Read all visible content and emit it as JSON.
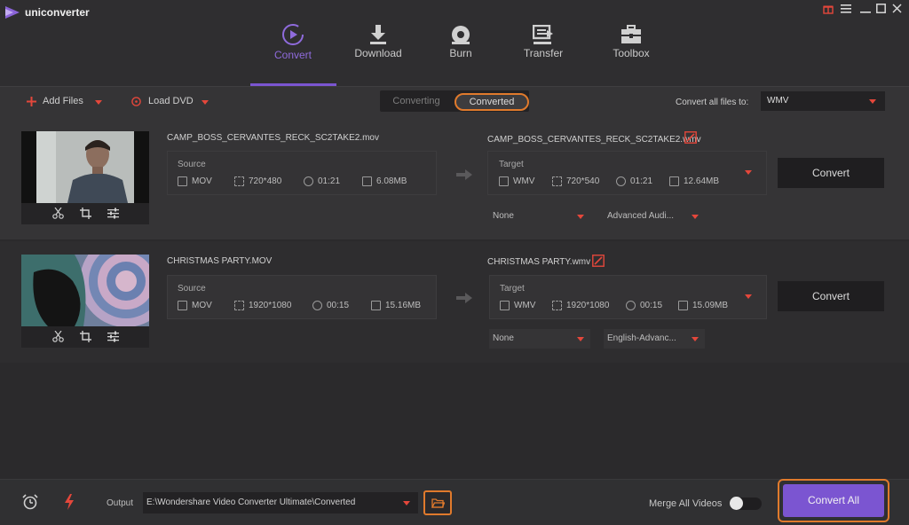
{
  "app": {
    "title": "uniconverter"
  },
  "nav": {
    "convert": "Convert",
    "download": "Download",
    "burn": "Burn",
    "transfer": "Transfer",
    "toolbox": "Toolbox"
  },
  "toolbar": {
    "add_files": "Add Files",
    "load_dvd": "Load DVD",
    "tab_converting": "Converting",
    "tab_converted": "Converted",
    "convert_all_to_label": "Convert all files to:",
    "convert_all_to_value": "WMV"
  },
  "items": [
    {
      "source_name": "CAMP_BOSS_CERVANTES_RECK_SC2TAKE2.mov",
      "source": {
        "label": "Source",
        "format": "MOV",
        "resolution": "720*480",
        "duration": "01:21",
        "size": "6.08MB"
      },
      "target_name": "CAMP_BOSS_CERVANTES_RECK_SC2TAKE2.wmv",
      "target": {
        "label": "Target",
        "format": "WMV",
        "resolution": "720*540",
        "duration": "01:21",
        "size": "12.64MB"
      },
      "subtitle": "None",
      "audio": "Advanced Audi...",
      "convert_label": "Convert"
    },
    {
      "source_name": "CHRISTMAS PARTY.MOV",
      "source": {
        "label": "Source",
        "format": "MOV",
        "resolution": "1920*1080",
        "duration": "00:15",
        "size": "15.16MB"
      },
      "target_name": "CHRISTMAS PARTY.wmv",
      "target": {
        "label": "Target",
        "format": "WMV",
        "resolution": "1920*1080",
        "duration": "00:15",
        "size": "15.09MB"
      },
      "subtitle": "None",
      "audio": "English-Advanc...",
      "convert_label": "Convert"
    }
  ],
  "bottom": {
    "output_label": "Output",
    "output_path": "E:\\Wondershare Video Converter Ultimate\\Converted",
    "merge_label": "Merge All Videos",
    "merge_on": false,
    "convert_all": "Convert All"
  },
  "colors": {
    "accent": "#7b55d1",
    "highlight": "#e07a2c",
    "caret": "#e4473b",
    "background": "#2b2a2c"
  }
}
